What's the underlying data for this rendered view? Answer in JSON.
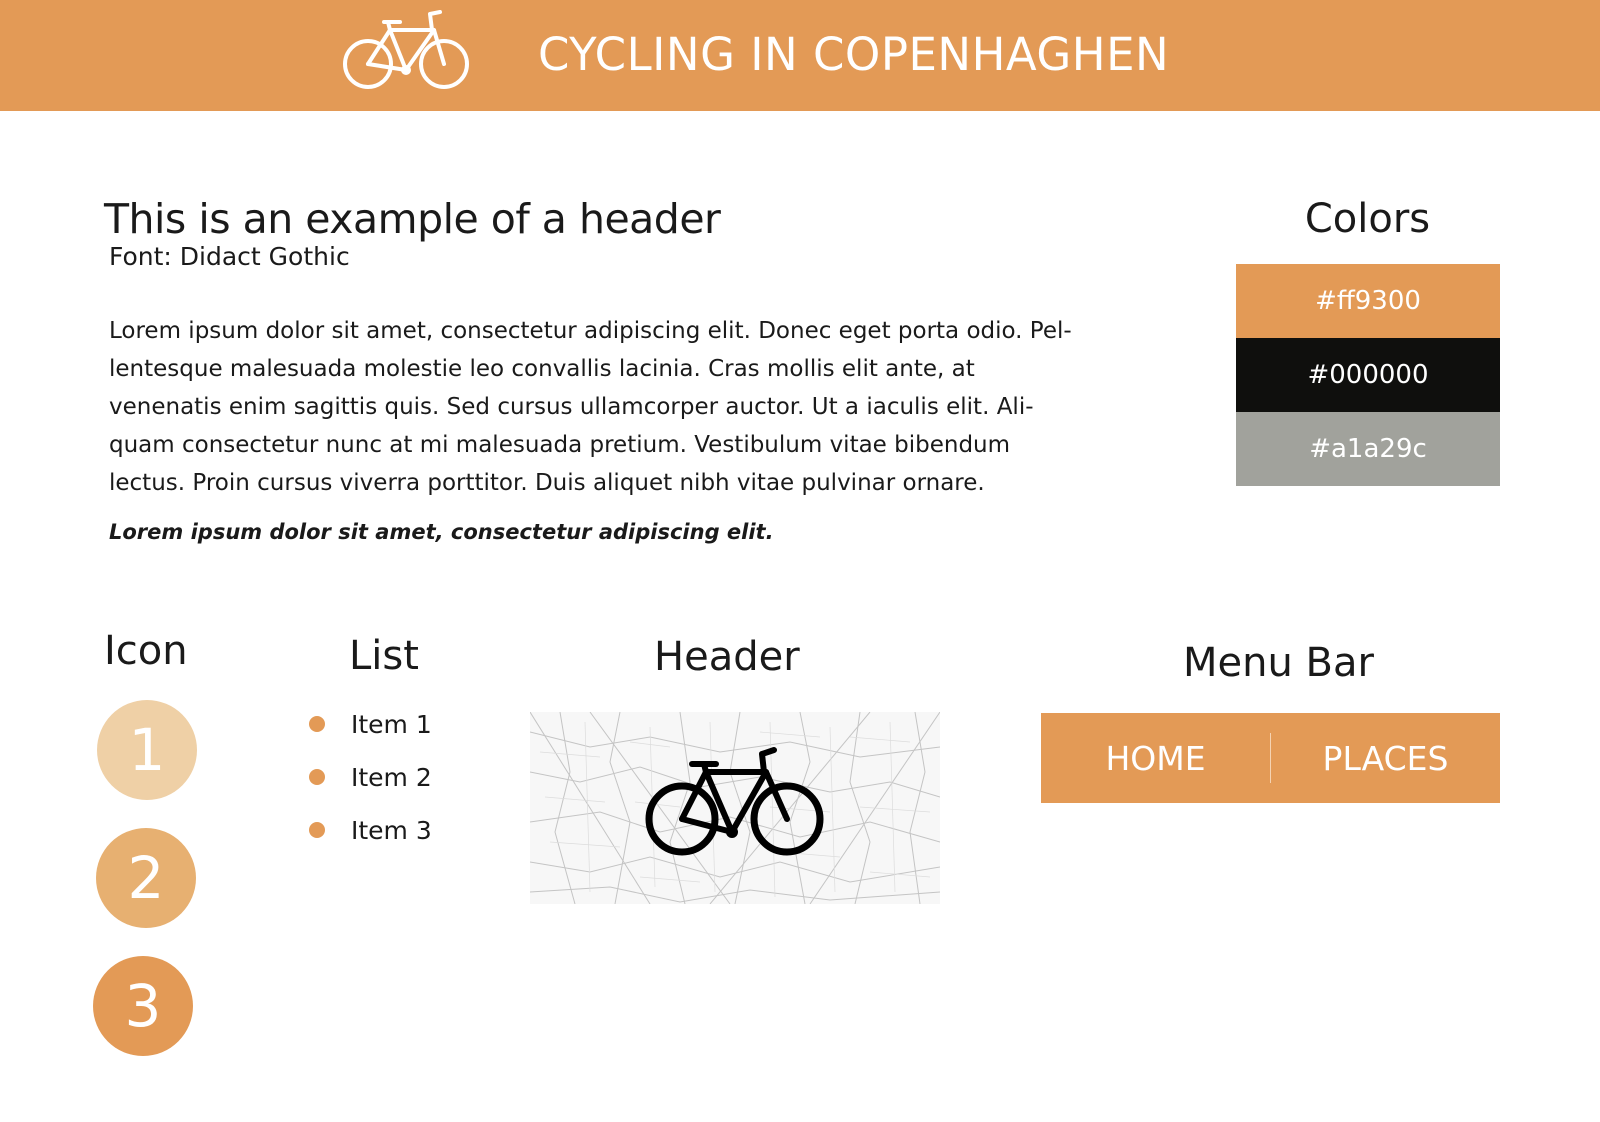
{
  "site": {
    "title": "CYCLING  IN COPENHAGHEN",
    "logo_icon": "bicycle-icon"
  },
  "typography": {
    "header": "This is an example of a header",
    "font_note": "Font:  Didact Gothic",
    "body_lines": [
      "Lorem ipsum dolor sit amet, consectetur adipiscing elit. Donec eget porta odio. Pel-",
      "lentesque malesuada molestie leo convallis lacinia. Cras mollis elit ante, at",
      "venenatis enim sagittis quis. Sed cursus ullamcorper auctor. Ut a iaculis elit. Ali-",
      "quam consectetur nunc at mi malesuada pretium. Vestibulum vitae bibendum",
      "lectus. Proin cursus viverra porttitor. Duis aliquet nibh vitae pulvinar ornare."
    ],
    "italic": "Lorem ipsum dolor sit amet, consectetur adipiscing elit."
  },
  "colors": {
    "title": "Colors",
    "swatches": [
      {
        "label": "#ff9300",
        "color": "#e39a56"
      },
      {
        "label": "#000000",
        "color": "#0f0f0d"
      },
      {
        "label": "#a1a29c",
        "color": "#a1a29c"
      }
    ]
  },
  "icon_section": {
    "title": "Icon",
    "items": [
      {
        "label": "1",
        "color": "#efd0a6"
      },
      {
        "label": "2",
        "color": "#e7b071"
      },
      {
        "label": "3",
        "color": "#e39a56"
      }
    ]
  },
  "list_section": {
    "title": "List",
    "items": [
      "Item 1",
      "Item 2",
      "Item 3"
    ],
    "bullet_color": "#e39a56"
  },
  "header_section": {
    "title": "Header",
    "image_icon": "bicycle-over-city-map"
  },
  "menu_section": {
    "title": "Menu  Bar",
    "items": [
      "HOME",
      "PLACES"
    ]
  }
}
